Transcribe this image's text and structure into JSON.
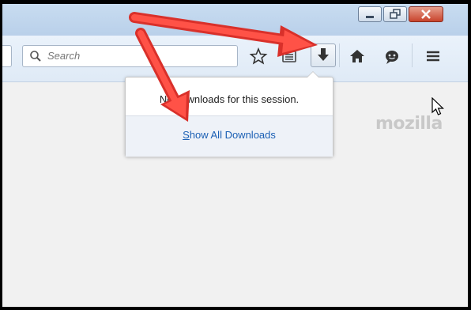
{
  "window": {
    "caption_buttons": [
      "minimize",
      "restore",
      "close"
    ]
  },
  "toolbar": {
    "search_placeholder": "Search",
    "icons": [
      "bookmark-star-icon",
      "reading-list-icon",
      "downloads-icon",
      "home-icon",
      "chat-icon",
      "menu-icon"
    ]
  },
  "page": {
    "logo_text": "mozilla"
  },
  "downloads_panel": {
    "message": "No downloads for this session.",
    "show_all_first_letter": "S",
    "show_all_rest": "how All Downloads"
  },
  "colors": {
    "annotation_arrow": "#e8473c",
    "link": "#1a5fb4"
  }
}
